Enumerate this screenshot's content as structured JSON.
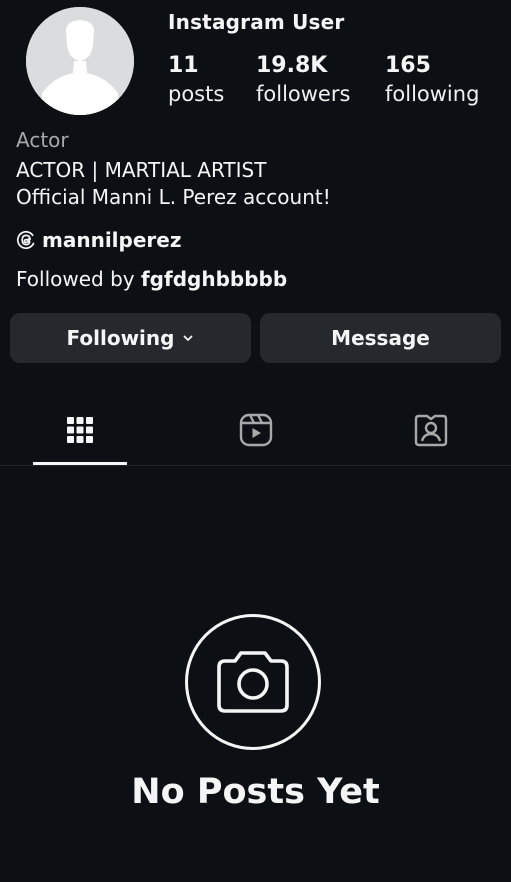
{
  "profile": {
    "username": "Instagram User",
    "stats": [
      {
        "value": "11",
        "label": "posts"
      },
      {
        "value": "19.8K",
        "label": "followers"
      },
      {
        "value": "165",
        "label": "following"
      }
    ],
    "category": "Actor",
    "bio": [
      "ACTOR | MARTIAL ARTIST",
      "Official Manni L. Perez account!"
    ],
    "threads_handle": "mannilperez",
    "followed_by_prefix": "Followed by ",
    "followed_by_user": "fgfdghbbbbb"
  },
  "buttons": {
    "following": "Following",
    "message": "Message"
  },
  "tabs": [
    {
      "icon": "grid-icon",
      "active": true
    },
    {
      "icon": "reels-icon",
      "active": false
    },
    {
      "icon": "tagged-icon",
      "active": false
    }
  ],
  "empty_state": {
    "icon": "camera-icon",
    "title": "No Posts Yet"
  },
  "colors": {
    "background": "#0c1014",
    "button": "#25292e",
    "secondary_text": "#a8a8a8"
  }
}
